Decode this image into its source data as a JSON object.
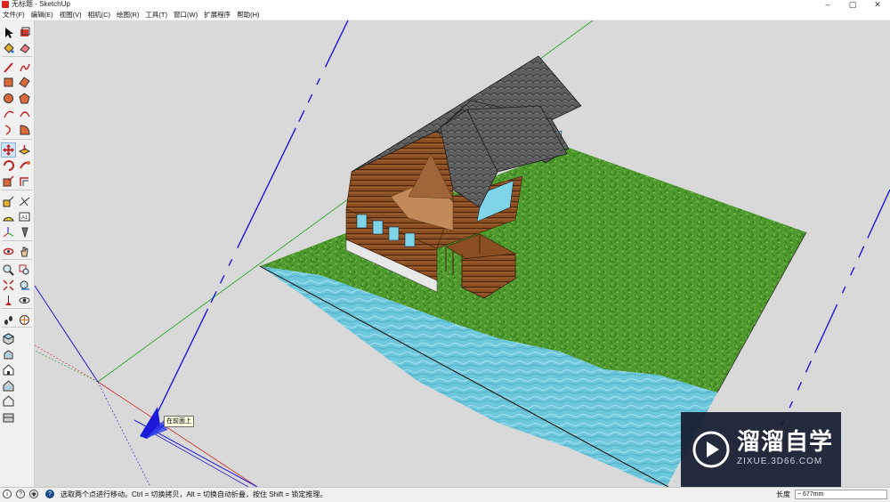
{
  "window": {
    "title": "无标题 - SketchUp",
    "controls": {
      "minimize": "‒",
      "maximize": "▢",
      "close": "✕"
    }
  },
  "menu": [
    "文件(F)",
    "编辑(E)",
    "视图(V)",
    "相机(C)",
    "绘图(R)",
    "工具(T)",
    "窗口(W)",
    "扩展程序",
    "帮助(H)"
  ],
  "toolbar": {
    "tools": [
      {
        "name": "select-tool",
        "icon": "arrow-icon"
      },
      {
        "name": "make-component-tool",
        "icon": "component-icon"
      },
      {
        "name": "paint-bucket-tool",
        "icon": "paint-bucket-icon"
      },
      {
        "name": "eraser-tool",
        "icon": "eraser-icon"
      },
      {
        "name": "line-tool",
        "icon": "pencil-icon"
      },
      {
        "name": "freehand-tool",
        "icon": "freehand-icon"
      },
      {
        "name": "rectangle-tool",
        "icon": "rectangle-icon"
      },
      {
        "name": "rotated-rectangle-tool",
        "icon": "rotated-rectangle-icon"
      },
      {
        "name": "circle-tool",
        "icon": "circle-icon"
      },
      {
        "name": "polygon-tool",
        "icon": "polygon-icon"
      },
      {
        "name": "arc-tool",
        "icon": "arc-icon"
      },
      {
        "name": "two-point-arc-tool",
        "icon": "two-point-arc-icon"
      },
      {
        "name": "three-point-arc-tool",
        "icon": "three-point-arc-icon"
      },
      {
        "name": "pie-tool",
        "icon": "pie-icon"
      },
      {
        "name": "move-tool",
        "icon": "move-icon",
        "active": true
      },
      {
        "name": "push-pull-tool",
        "icon": "push-pull-icon"
      },
      {
        "name": "rotate-tool",
        "icon": "rotate-icon"
      },
      {
        "name": "follow-me-tool",
        "icon": "follow-me-icon"
      },
      {
        "name": "scale-tool",
        "icon": "scale-icon"
      },
      {
        "name": "offset-tool",
        "icon": "offset-icon"
      },
      {
        "name": "tape-measure-tool",
        "icon": "tape-measure-icon"
      },
      {
        "name": "dimension-tool",
        "icon": "dimension-icon"
      },
      {
        "name": "protractor-tool",
        "icon": "protractor-icon"
      },
      {
        "name": "text-tool",
        "icon": "text-icon"
      },
      {
        "name": "axes-tool",
        "icon": "axes-icon"
      },
      {
        "name": "3d-text-tool",
        "icon": "3d-text-icon"
      },
      {
        "name": "orbit-tool",
        "icon": "orbit-icon"
      },
      {
        "name": "pan-tool",
        "icon": "pan-icon"
      },
      {
        "name": "zoom-tool",
        "icon": "zoom-icon"
      },
      {
        "name": "zoom-window-tool",
        "icon": "zoom-window-icon"
      },
      {
        "name": "zoom-extents-tool",
        "icon": "zoom-extents-icon"
      },
      {
        "name": "previous-view-tool",
        "icon": "previous-view-icon"
      },
      {
        "name": "position-camera-tool",
        "icon": "position-camera-icon"
      },
      {
        "name": "look-around-tool",
        "icon": "look-around-icon"
      },
      {
        "name": "walk-tool",
        "icon": "walk-icon"
      },
      {
        "name": "section-plane-tool",
        "icon": "section-plane-icon"
      },
      {
        "name": "iso-view",
        "icon": "iso-view-icon"
      },
      {
        "name": "top-view",
        "icon": "top-view-icon"
      },
      {
        "name": "front-view",
        "icon": "front-view-icon"
      },
      {
        "name": "right-view",
        "icon": "right-view-icon"
      },
      {
        "name": "back-view",
        "icon": "back-view-icon"
      },
      {
        "name": "left-view",
        "icon": "left-view-icon"
      }
    ]
  },
  "viewport": {
    "tooltip": "在前面上",
    "colors": {
      "background": "#d9d9d9",
      "grass": "#4e9a2e",
      "water": "#6ec8dc",
      "wood": "#8a4e22",
      "roof": "#5a5a5a",
      "glass": "#7fd4e8",
      "axis_red": "#d02020",
      "axis_green": "#20a020",
      "axis_blue": "#1a1ad8"
    }
  },
  "watermark": {
    "title": "溜溜自学",
    "subtitle": "ZIXUE.3D66.COM"
  },
  "statusbar": {
    "icons": [
      "info-icon",
      "help-icon",
      "user-icon",
      "geo-icon"
    ],
    "message": "选取两个点进行移动。Ctrl = 切换拷贝，Alt = 切换自动折叠，按住 Shift = 锁定推理。",
    "measure_label": "长度",
    "measure_value": "~ 677mm"
  }
}
